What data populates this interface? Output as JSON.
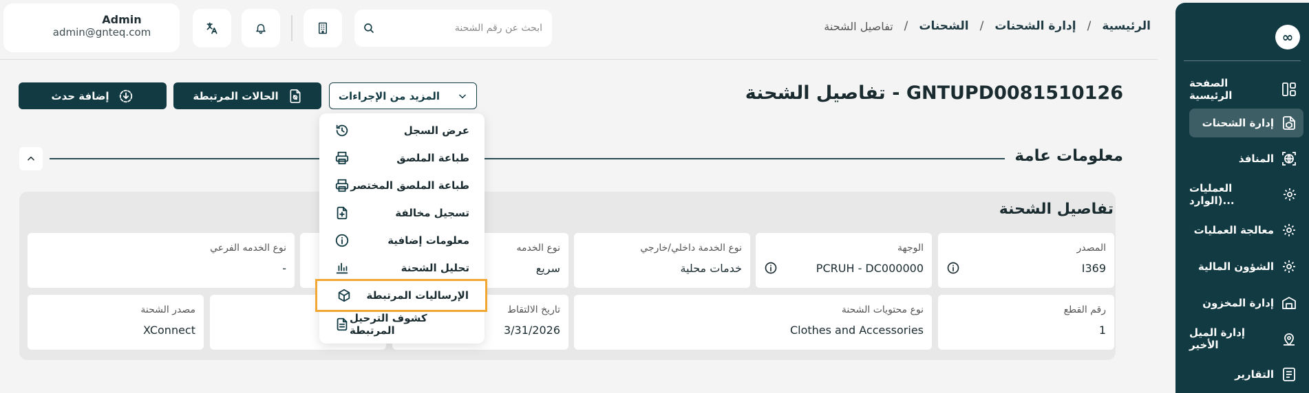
{
  "user": {
    "name": "Admin",
    "email": "admin@gnteq.com"
  },
  "search": {
    "placeholder": "ابحث عن رقم الشحنة"
  },
  "breadcrumb": {
    "items": [
      "الرئيسية",
      "إدارة الشحنات",
      "الشحنات"
    ],
    "separator": "/",
    "current": "تفاصيل الشحنة"
  },
  "page": {
    "title": "تفاصيل الشحنة - GNTUPD0081510126",
    "more_actions_label": "المزيد من الإجراءات",
    "related_cases_label": "الحالات المرتبطة",
    "add_event_label": "إضافة حدث"
  },
  "section": {
    "title": "معلومات عامة",
    "panel_title": "تفاصيل الشحنة"
  },
  "sidebar": {
    "logo": "∞",
    "items": [
      {
        "label": "الصفحة الرئيسية",
        "icon": "dashboard-icon"
      },
      {
        "label": "إدارة الشحنات",
        "icon": "shipment-box-icon",
        "active": true
      },
      {
        "label": "المنافذ",
        "icon": "globe-icon"
      },
      {
        "label": "العمليات (الوارد...",
        "icon": "gear-icon"
      },
      {
        "label": "معالجة العمليات",
        "icon": "gear-icon"
      },
      {
        "label": "الشؤون المالية",
        "icon": "gear-icon"
      },
      {
        "label": "إدارة المخزون",
        "icon": "warehouse-icon"
      },
      {
        "label": "إدارة الميل الأخير",
        "icon": "location-icon"
      },
      {
        "label": "التقارير",
        "icon": "report-icon"
      }
    ]
  },
  "dropdown": {
    "items": [
      {
        "label": "عرض السجل",
        "icon": "history-icon"
      },
      {
        "label": "طباعة الملصق",
        "icon": "printer-icon"
      },
      {
        "label": "طباعة الملصق المختصر",
        "icon": "printer-icon"
      },
      {
        "label": "تسجيل مخالفة",
        "icon": "file-add-icon"
      },
      {
        "label": "معلومات إضافية",
        "icon": "info-icon"
      },
      {
        "label": "تحليل الشحنة",
        "icon": "bar-chart-icon"
      },
      {
        "label": "الإرساليات المرتبطة",
        "icon": "package-icon",
        "highlighted": true
      },
      {
        "label": "كشوف الترحيل المرتبطة",
        "icon": "document-icon"
      }
    ]
  },
  "fields": {
    "row1": [
      {
        "label": "المصدر",
        "value": "I369"
      },
      {
        "label": "الوجهة",
        "value": "PCRUH - DC000000"
      },
      {
        "label": "نوع الخدمة داخلي/خارجي",
        "value": "خدمات محلية"
      },
      {
        "label": "نوع الخدمه",
        "value": "سريع"
      },
      {
        "label": "نوع الخدمه الفرعي",
        "value": "-"
      }
    ],
    "row2": [
      {
        "label": "رقم القطع",
        "value": "1"
      },
      {
        "label": "نوع محتويات الشحنة",
        "value": "Clothes and Accessories"
      },
      {
        "label": "تاريخ الالتقاط",
        "value": "3/31/2026"
      },
      {
        "label": "مصدر الشحنة",
        "value": "XConnect"
      }
    ]
  },
  "colors": {
    "primary": "#123a43",
    "highlight": "#f2a733",
    "background": "#f4f4f4"
  }
}
